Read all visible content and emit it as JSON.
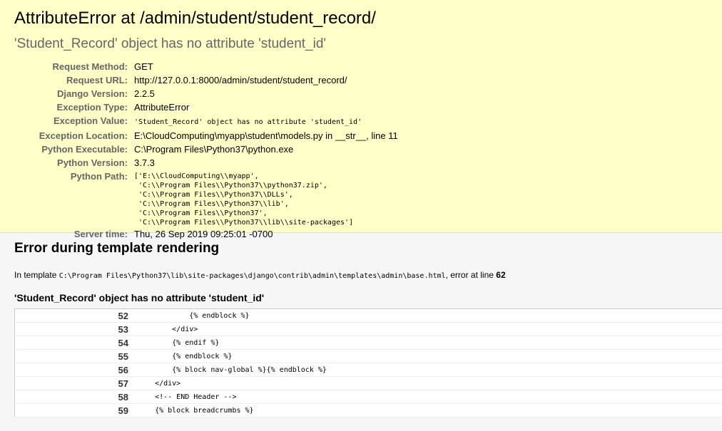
{
  "summary": {
    "title": "AttributeError at /admin/student/student_record/",
    "subtitle": "'Student_Record' object has no attribute 'student_id'",
    "rows": [
      {
        "label": "Request Method:",
        "value": "GET",
        "mono": false
      },
      {
        "label": "Request URL:",
        "value": "http://127.0.0.1:8000/admin/student/student_record/",
        "mono": false
      },
      {
        "label": "Django Version:",
        "value": "2.2.5",
        "mono": false
      },
      {
        "label": "Exception Type:",
        "value": "AttributeError",
        "mono": false
      },
      {
        "label": "Exception Value:",
        "value": "'Student_Record' object has no attribute 'student_id'",
        "mono": true
      },
      {
        "label": "Exception Location:",
        "value": "E:\\CloudComputing\\myapp\\student\\models.py in __str__, line 11",
        "mono": false
      },
      {
        "label": "Python Executable:",
        "value": "C:\\Program Files\\Python37\\python.exe",
        "mono": false
      },
      {
        "label": "Python Version:",
        "value": "3.7.3",
        "mono": false
      }
    ],
    "python_path_label": "Python Path:",
    "python_path": "['E:\\\\CloudComputing\\\\myapp',\n 'C:\\\\Program Files\\\\Python37\\\\python37.zip',\n 'C:\\\\Program Files\\\\Python37\\\\DLLs',\n 'C:\\\\Program Files\\\\Python37\\\\lib',\n 'C:\\\\Program Files\\\\Python37',\n 'C:\\\\Program Files\\\\Python37\\\\lib\\\\site-packages']",
    "server_time_label": "Server time:",
    "server_time": "Thu, 26 Sep 2019 09:25:01 -0700"
  },
  "template": {
    "heading": "Error during template rendering",
    "intro_prefix": "In template ",
    "template_path": "C:\\Program Files\\Python37\\lib\\site-packages\\django\\contrib\\admin\\templates\\admin\\base.html",
    "intro_middle": ", error at line ",
    "error_line": "62",
    "error_message": "'Student_Record' object has no attribute 'student_id'",
    "source_lines": [
      {
        "num": "52",
        "code": "            {% endblock %}"
      },
      {
        "num": "53",
        "code": "        </div>"
      },
      {
        "num": "54",
        "code": "        {% endif %}"
      },
      {
        "num": "55",
        "code": "        {% endblock %}"
      },
      {
        "num": "56",
        "code": "        {% block nav-global %}{% endblock %}"
      },
      {
        "num": "57",
        "code": "    </div>"
      },
      {
        "num": "58",
        "code": "    <!-- END Header -->"
      },
      {
        "num": "59",
        "code": "    {% block breadcrumbs %}"
      }
    ]
  }
}
